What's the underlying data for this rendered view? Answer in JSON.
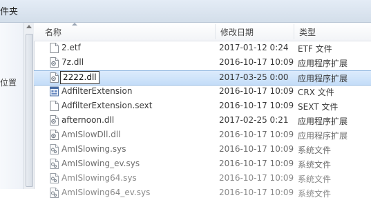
{
  "window": {
    "title_partial": "件夹"
  },
  "nav": {
    "label_partial": "位置"
  },
  "columns": {
    "name": "名称",
    "modified": "修改日期",
    "type": "类型"
  },
  "files": [
    {
      "name": "2.etf",
      "modified": "2017-01-12 0:24",
      "type": "ETF 文件",
      "icon": "blank-file-icon"
    },
    {
      "name": "7z.dll",
      "modified": "2016-10-17 10:09",
      "type": "应用程序扩展",
      "icon": "dll-gear-icon"
    },
    {
      "name": "2222.dll",
      "modified": "2017-03-25 0:00",
      "type": "应用程序扩展",
      "icon": "dll-gear-icon",
      "selected": true,
      "editing": true
    },
    {
      "name": "AdfilterExtension",
      "modified": "2016-10-17 10:09",
      "type": "CRX 文件",
      "icon": "crx-file-icon"
    },
    {
      "name": "AdfilterExtension.sext",
      "modified": "2016-10-17 10:09",
      "type": "SEXT 文件",
      "icon": "blank-file-icon"
    },
    {
      "name": "afternoon.dll",
      "modified": "2017-02-25 0:21",
      "type": "应用程序扩展",
      "icon": "dll-gear-icon"
    },
    {
      "name": "AmISlowDll.dll",
      "modified": "2016-10-17 10:09",
      "type": "应用程序扩展",
      "icon": "dll-gear-icon"
    },
    {
      "name": "AmISlowing.sys",
      "modified": "2016-10-17 10:09",
      "type": "系统文件",
      "icon": "sys-gear-icon"
    },
    {
      "name": "AmISlowing_ev.sys",
      "modified": "2016-10-17 10:09",
      "type": "系统文件",
      "icon": "sys-gear-icon"
    },
    {
      "name": "AmISlowing64.sys",
      "modified": "2016-10-17 10:09",
      "type": "系统文件",
      "icon": "sys-gear-icon"
    },
    {
      "name": "AmISlowing64_ev.sys",
      "modified": "2016-10-17 10:09",
      "type": "系统文件",
      "icon": "sys-gear-icon"
    }
  ]
}
